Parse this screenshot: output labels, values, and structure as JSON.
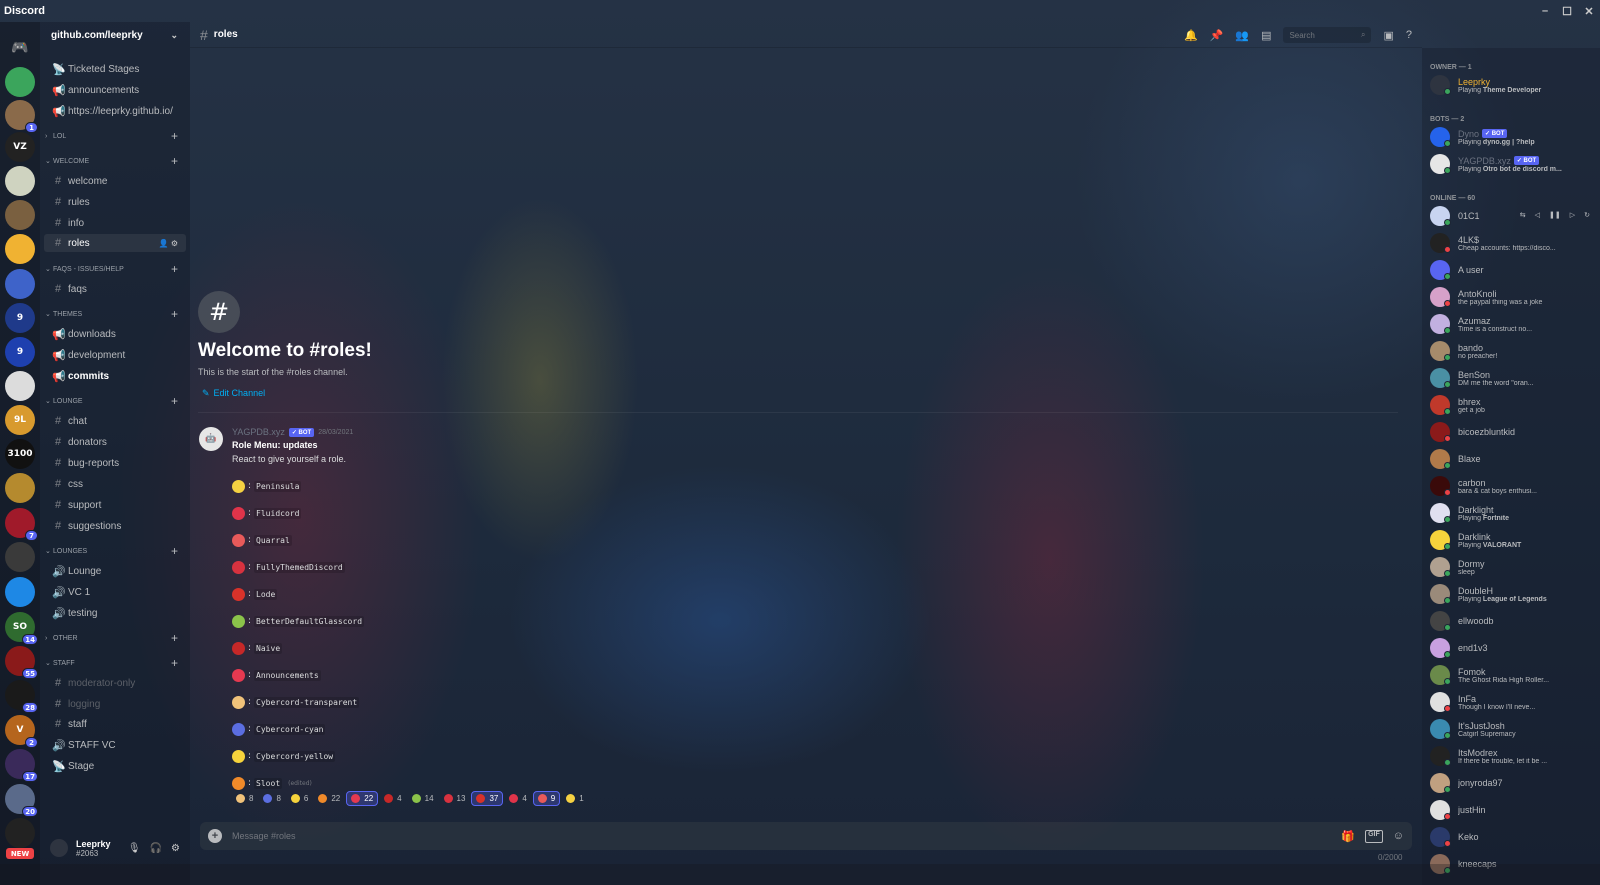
{
  "app": {
    "title": "Discord"
  },
  "window_controls": [
    "–",
    "☐",
    "✕"
  ],
  "servers": [
    {
      "label": "",
      "color": "#5865f2",
      "badge": ""
    },
    {
      "label": "",
      "color": "#3ba55c",
      "badge": ""
    },
    {
      "label": "",
      "color": "#8a6a4a",
      "badge": "1"
    },
    {
      "label": "VZ",
      "color": "#222222",
      "badge": ""
    },
    {
      "label": "",
      "color": "#cfd3c0",
      "badge": ""
    },
    {
      "label": "",
      "color": "#7a6040",
      "badge": ""
    },
    {
      "label": "",
      "color": "#f0b232",
      "badge": ""
    },
    {
      "label": "",
      "color": "#3e63c9",
      "badge": ""
    },
    {
      "label": "9",
      "color": "#1f3a8a",
      "badge": ""
    },
    {
      "label": "9",
      "color": "#1e40af",
      "badge": ""
    },
    {
      "label": "",
      "color": "#dcdcdc",
      "badge": ""
    },
    {
      "label": "9L",
      "color": "#d89a2e",
      "badge": ""
    },
    {
      "label": "3100",
      "color": "#111111",
      "badge": ""
    },
    {
      "label": "",
      "color": "#b58a2e",
      "badge": ""
    },
    {
      "label": "",
      "color": "#a01a2a",
      "badge": "7"
    },
    {
      "label": "",
      "color": "#3a3a3a",
      "badge": ""
    },
    {
      "label": "",
      "color": "#1e88e5",
      "badge": ""
    },
    {
      "label": "SO",
      "color": "#2f6b2f",
      "badge": "14"
    },
    {
      "label": "",
      "color": "#8a1a1a",
      "badge": "55"
    },
    {
      "label": "",
      "color": "#1a1a1a",
      "badge": "28"
    },
    {
      "label": "V",
      "color": "#b5651d",
      "badge": "2"
    },
    {
      "label": "",
      "color": "#3a2a5a",
      "badge": "17"
    },
    {
      "label": "",
      "color": "#5a6a8a",
      "badge": "20"
    },
    {
      "label": "",
      "color": "#222222",
      "badge": ""
    }
  ],
  "new_badge": "NEW",
  "guild": {
    "name": "github.com/leeprky"
  },
  "channels": [
    {
      "type": "stage",
      "name": "Ticketed Stages"
    },
    {
      "type": "announce",
      "name": "announcements"
    },
    {
      "type": "announce",
      "name": "https://leeprky.github.io/"
    },
    {
      "type": "category",
      "name": "LOL",
      "collapsed": true
    },
    {
      "type": "category",
      "name": "WELCOME"
    },
    {
      "type": "text",
      "name": "welcome"
    },
    {
      "type": "text",
      "name": "rules"
    },
    {
      "type": "text",
      "name": "info"
    },
    {
      "type": "text",
      "name": "roles",
      "active": true
    },
    {
      "type": "category",
      "name": "FAQS - ISSUES/HELP"
    },
    {
      "type": "text",
      "name": "faqs"
    },
    {
      "type": "category",
      "name": "THEMES"
    },
    {
      "type": "announce",
      "name": "downloads"
    },
    {
      "type": "announce",
      "name": "development"
    },
    {
      "type": "announce",
      "name": "commits",
      "unread": true
    },
    {
      "type": "category",
      "name": "LOUNGE"
    },
    {
      "type": "text",
      "name": "chat"
    },
    {
      "type": "text",
      "name": "donators"
    },
    {
      "type": "text",
      "name": "bug-reports"
    },
    {
      "type": "text",
      "name": "css"
    },
    {
      "type": "text",
      "name": "support"
    },
    {
      "type": "text",
      "name": "suggestions"
    },
    {
      "type": "category",
      "name": "LOUNGES"
    },
    {
      "type": "voice",
      "name": "Lounge"
    },
    {
      "type": "voice",
      "name": "VC 1"
    },
    {
      "type": "voice",
      "name": "testing"
    },
    {
      "type": "category",
      "name": "OTHER",
      "collapsed": true
    },
    {
      "type": "category",
      "name": "STAFF"
    },
    {
      "type": "text",
      "name": "moderator-only",
      "muted": true
    },
    {
      "type": "text",
      "name": "logging",
      "muted": true
    },
    {
      "type": "text",
      "name": "staff"
    },
    {
      "type": "voice",
      "name": "STAFF VC"
    },
    {
      "type": "stage",
      "name": "Stage"
    }
  ],
  "user": {
    "name": "Leeprky",
    "tag": "#2063"
  },
  "header": {
    "channel": "roles",
    "search_placeholder": "Search"
  },
  "welcome": {
    "title": "Welcome to #roles!",
    "subtitle": "This is the start of the #roles channel.",
    "edit_label": "Edit Channel"
  },
  "message": {
    "author": "YAGPDB.xyz",
    "bot_label": "✓ BOT",
    "timestamp": "28/03/2021",
    "title": "Role Menu: updates",
    "text": "React to give yourself a role.",
    "roles": [
      {
        "emoji_color": "#f5d142",
        "name": "Peninsula"
      },
      {
        "emoji_color": "#e0344a",
        "name": "Fluidcord"
      },
      {
        "emoji_color": "#e85a5a",
        "name": "Quarral"
      },
      {
        "emoji_color": "#d8323f",
        "name": "FullyThemedDiscord"
      },
      {
        "emoji_color": "#d8322a",
        "name": "Lode"
      },
      {
        "emoji_color": "#8bc34a",
        "name": "BetterDefaultGlasscord"
      },
      {
        "emoji_color": "#c62828",
        "name": "Naive"
      },
      {
        "emoji_color": "#e53950",
        "name": "Announcements"
      },
      {
        "emoji_color": "#f0c27a",
        "name": "Cybercord-transparent"
      },
      {
        "emoji_color": "#5b6ee1",
        "name": "Cybercord-cyan"
      },
      {
        "emoji_color": "#f6d33c",
        "name": "Cybercord-yellow"
      },
      {
        "emoji_color": "#f08a2a",
        "name": "Sloot",
        "edited": "(edited)"
      }
    ],
    "reactions": [
      {
        "color": "#f0c27a",
        "count": "8",
        "me": false
      },
      {
        "color": "#5b6ee1",
        "count": "8",
        "me": false
      },
      {
        "color": "#f6d33c",
        "count": "6",
        "me": false
      },
      {
        "color": "#f08a2a",
        "count": "22",
        "me": false
      },
      {
        "color": "#e53950",
        "count": "22",
        "me": true
      },
      {
        "color": "#c62828",
        "count": "4",
        "me": false
      },
      {
        "color": "#8bc34a",
        "count": "14",
        "me": false
      },
      {
        "color": "#d8323f",
        "count": "13",
        "me": false
      },
      {
        "color": "#d8322a",
        "count": "37",
        "me": true
      },
      {
        "color": "#e0344a",
        "count": "4",
        "me": false
      },
      {
        "color": "#e85a5a",
        "count": "9",
        "me": true
      },
      {
        "color": "#f5d142",
        "count": "1",
        "me": false
      }
    ]
  },
  "composer": {
    "placeholder": "Message #roles",
    "gif_label": "GIF",
    "counter": "0/2000"
  },
  "members": {
    "owner_cat": "OWNER — 1",
    "bots_cat": "BOTS — 2",
    "online_cat": "ONLINE — 60",
    "owner": [
      {
        "name": "Leeprky",
        "name_color": "#f0b232",
        "status_prefix": "Playing",
        "status_bold": "Theme Developer",
        "presence": "#3ba55c",
        "avatar": "#2e3440"
      }
    ],
    "bots": [
      {
        "name": "Dyno",
        "name_color": "#6b7280",
        "status_prefix": "Playing",
        "status_bold": "dyno.gg | ?help",
        "presence": "#3ba55c",
        "avatar": "#2563eb"
      },
      {
        "name": "YAGPDB.xyz",
        "name_color": "#6b7280",
        "status_prefix": "Playing",
        "status_bold": "Otro bot de discord m...",
        "presence": "#3ba55c",
        "avatar": "#e6e6e6"
      }
    ],
    "online": [
      {
        "name": "01C1",
        "status": "",
        "presence": "#3ba55c",
        "avatar": "#c8d4f0",
        "media": [
          "⇆",
          "◁",
          "❚❚",
          "▷",
          "↻"
        ]
      },
      {
        "name": "4LK$",
        "status": "Cheap accounts: https://disco...",
        "presence": "#ed4245",
        "avatar": "#222222"
      },
      {
        "name": "A user",
        "status": "",
        "presence": "#3ba55c",
        "avatar": "#5865f2"
      },
      {
        "name": "AntoKnoli",
        "status": "the paypal thing was a joke",
        "presence": "#ed4245",
        "avatar": "#d6a1c9"
      },
      {
        "name": "Azumaz",
        "status": "Time is a construct no...",
        "presence": "#3ba55c",
        "avatar": "#c2b0e0"
      },
      {
        "name": "bando",
        "status": "no preacher!",
        "presence": "#3ba55c",
        "avatar": "#a68b6b"
      },
      {
        "name": "BenSon",
        "status": "DM me the word \"oran...",
        "presence": "#3ba55c",
        "avatar": "#4a90a4"
      },
      {
        "name": "bhrex",
        "status": "get a job",
        "presence": "#3ba55c",
        "avatar": "#c0392b"
      },
      {
        "name": "bicoezbluntkid",
        "status": "",
        "presence": "#ed4245",
        "avatar": "#8b1a1a"
      },
      {
        "name": "Blaxe",
        "status": "",
        "presence": "#3ba55c",
        "avatar": "#b07a4a"
      },
      {
        "name": "carbon",
        "status": "bara & cat boys enthusi...",
        "presence": "#ed4245",
        "avatar": "#3a0a0a"
      },
      {
        "name": "Darklight",
        "status_prefix": "Playing",
        "status_bold": "Fortnite",
        "presence": "#3ba55c",
        "avatar": "#e0e0f0"
      },
      {
        "name": "Darklink",
        "status_prefix": "Playing",
        "status_bold": "VALORANT",
        "presence": "#3ba55c",
        "avatar": "#f6d33c"
      },
      {
        "name": "Dormy",
        "status": "sleep",
        "presence": "#3ba55c",
        "avatar": "#b0a090"
      },
      {
        "name": "DoubleH",
        "status_prefix": "Playing",
        "status_bold": "League of Legends",
        "presence": "#3ba55c",
        "avatar": "#9a8a7a"
      },
      {
        "name": "ellwoodb",
        "status": "",
        "presence": "#3ba55c",
        "avatar": "#444444"
      },
      {
        "name": "end1v3",
        "status": "",
        "presence": "#3ba55c",
        "avatar": "#c8a0e0"
      },
      {
        "name": "Fomok",
        "status": "The Ghost Rida High Roller...",
        "presence": "#3ba55c",
        "avatar": "#6a8a4a"
      },
      {
        "name": "InFa",
        "status": "Though I know I'll neve...",
        "presence": "#ed4245",
        "avatar": "#e0e0e0"
      },
      {
        "name": "It'sJustJosh",
        "status": "Catgirl Supremacy",
        "presence": "#3ba55c",
        "avatar": "#3a8ab0"
      },
      {
        "name": "ItsModrex",
        "status": "If there be trouble, let it be ...",
        "presence": "#3ba55c",
        "avatar": "#222222"
      },
      {
        "name": "jonyroda97",
        "status": "",
        "presence": "#3ba55c",
        "avatar": "#c0a080"
      },
      {
        "name": "justHin",
        "status": "",
        "presence": "#ed4245",
        "avatar": "#e0e0e0"
      },
      {
        "name": "Keko",
        "status": "",
        "presence": "#ed4245",
        "avatar": "#2a3a6a"
      },
      {
        "name": "kneecaps",
        "status": "",
        "presence": "#3ba55c",
        "avatar": "#8a6a5a"
      }
    ]
  }
}
